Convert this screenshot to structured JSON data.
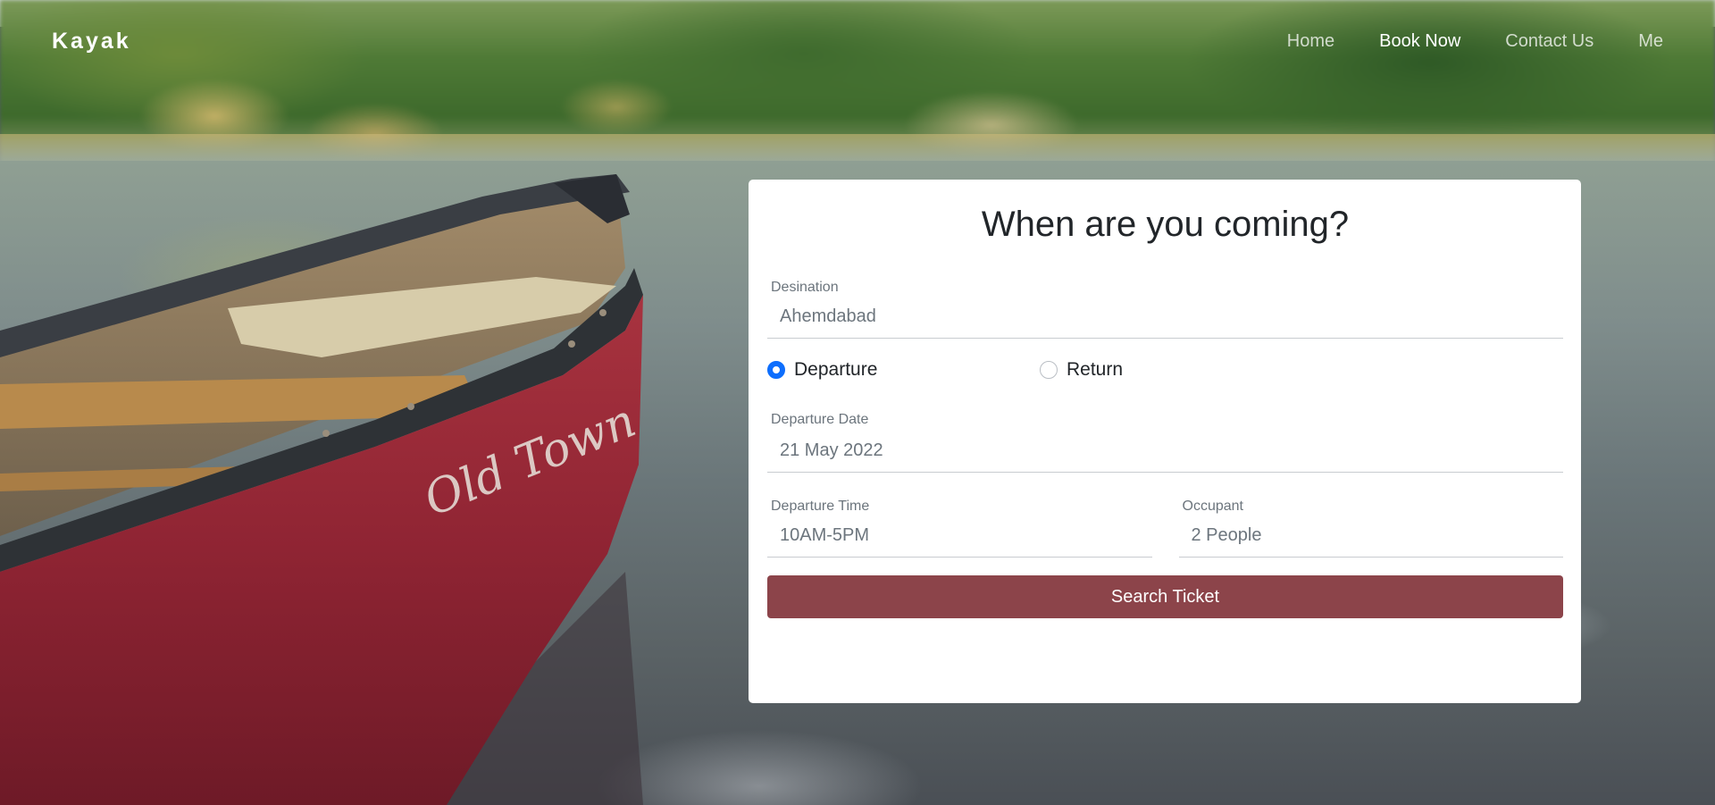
{
  "nav": {
    "brand": "Kayak",
    "links": [
      {
        "label": "Home",
        "active": false
      },
      {
        "label": "Book Now",
        "active": true
      },
      {
        "label": "Contact Us",
        "active": false
      },
      {
        "label": "Me",
        "active": false
      }
    ]
  },
  "booking": {
    "title": "When are you coming?",
    "destination": {
      "label": "Desination",
      "value": "Ahemdabad"
    },
    "trip_type": {
      "options": [
        "Departure",
        "Return"
      ],
      "selected": "Departure"
    },
    "departure_date": {
      "label": "Departure Date",
      "value": "21 May 2022"
    },
    "departure_time": {
      "label": "Departure Time",
      "value": "10AM-5PM"
    },
    "occupant": {
      "label": "Occupant",
      "value": "2 People"
    },
    "submit_label": "Search Ticket"
  },
  "colors": {
    "button": "#8c444a",
    "radio_checked": "#0d6efd",
    "card_bg": "#ffffff"
  },
  "canoe_text": "Old Town"
}
